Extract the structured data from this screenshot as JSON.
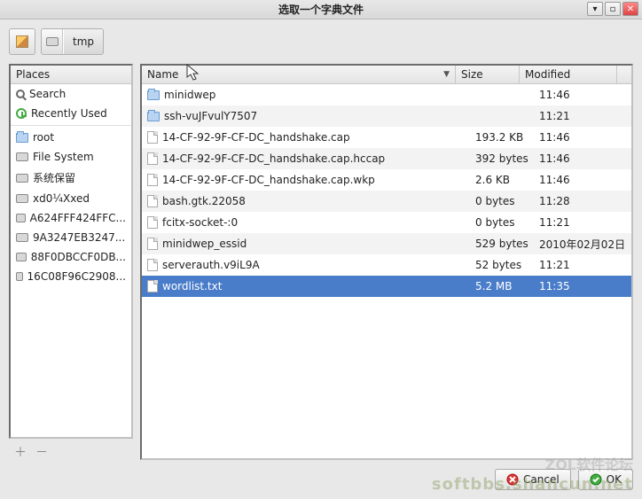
{
  "window": {
    "title": "选取一个字典文件"
  },
  "breadcrumb": {
    "segment": "tmp"
  },
  "places": {
    "header": "Places",
    "items": [
      {
        "icon": "search",
        "label": "Search"
      },
      {
        "icon": "recent",
        "label": "Recently Used"
      }
    ],
    "locations": [
      {
        "icon": "folder",
        "label": "root"
      },
      {
        "icon": "drive",
        "label": "File System"
      },
      {
        "icon": "drive",
        "label": "系统保留"
      },
      {
        "icon": "drive",
        "label": "xd0¼Xxed"
      },
      {
        "icon": "drive",
        "label": "A624FFF424FFC..."
      },
      {
        "icon": "drive",
        "label": "9A3247EB3247..."
      },
      {
        "icon": "drive",
        "label": "88F0DBCCF0DB..."
      },
      {
        "icon": "drive",
        "label": "16C08F96C2908..."
      }
    ]
  },
  "columns": {
    "name": "Name",
    "size": "Size",
    "modified": "Modified"
  },
  "files": [
    {
      "type": "folder",
      "name": "minidwep",
      "size": "",
      "modified": "11:46"
    },
    {
      "type": "folder",
      "name": "ssh-vuJFvulY7507",
      "size": "",
      "modified": "11:21"
    },
    {
      "type": "file",
      "name": "14-CF-92-9F-CF-DC_handshake.cap",
      "size": "193.2 KB",
      "modified": "11:46"
    },
    {
      "type": "file",
      "name": "14-CF-92-9F-CF-DC_handshake.cap.hccap",
      "size": "392 bytes",
      "modified": "11:46"
    },
    {
      "type": "file",
      "name": "14-CF-92-9F-CF-DC_handshake.cap.wkp",
      "size": "2.6 KB",
      "modified": "11:46"
    },
    {
      "type": "file",
      "name": "bash.gtk.22058",
      "size": "0 bytes",
      "modified": "11:28"
    },
    {
      "type": "file",
      "name": "fcitx-socket-:0",
      "size": "0 bytes",
      "modified": "11:21"
    },
    {
      "type": "file",
      "name": "minidwep_essid",
      "size": "529 bytes",
      "modified": "2010年02月02日"
    },
    {
      "type": "file",
      "name": "serverauth.v9iL9A",
      "size": "52 bytes",
      "modified": "11:21"
    },
    {
      "type": "file",
      "name": "wordlist.txt",
      "size": "5.2 MB",
      "modified": "11:35",
      "selected": true
    }
  ],
  "buttons": {
    "cancel": "Cancel",
    "ok": "OK"
  },
  "watermark": {
    "line1": "ZOL软件论坛",
    "line2": "softbbs.shancun.net"
  }
}
